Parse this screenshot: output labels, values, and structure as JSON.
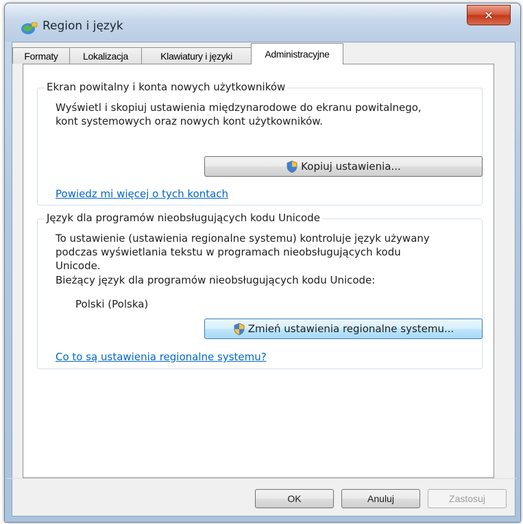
{
  "window": {
    "title": "Region i język",
    "close_label": "✕"
  },
  "tabs": [
    {
      "label": "Formaty",
      "active": false
    },
    {
      "label": "Lokalizacja",
      "active": false
    },
    {
      "label": "Klawiatury i języki",
      "active": false
    },
    {
      "label": "Administracyjne",
      "active": true
    }
  ],
  "welcome_group": {
    "title": "Ekran powitalny i konta nowych użytkowników",
    "description_line1": "Wyświetl i skopiuj ustawienia międzynarodowe do ekranu powitalnego,",
    "description_line2": "kont systemowych oraz nowych kont użytkowników.",
    "copy_button_label": "Kopiuj ustawienia...",
    "link_label": "Powiedz mi więcej o tych kontach"
  },
  "unicode_group": {
    "title": "Język dla programów nieobsługujących kodu Unicode",
    "description_line1": "To ustawienie (ustawienia regionalne systemu) kontroluje język używany",
    "description_line2": "podczas wyświetlania tekstu w programach nieobsługujących kodu",
    "description_line3": "Unicode.",
    "current_label": "Bieżący język dla programów nieobsługujących kodu Unicode:",
    "current_value": "Polski (Polska)",
    "change_button_label": "Zmień ustawienia regionalne systemu...",
    "link_label": "Co to są ustawienia regionalne systemu?"
  },
  "footer": {
    "ok_label": "OK",
    "cancel_label": "Anuluj",
    "apply_label": "Zastosuj"
  },
  "colors": {
    "link": "#0066cc",
    "close_button": "#c3391c",
    "focused_button": "#3c7fb1"
  },
  "icons": {
    "app": "globe-icon",
    "shield": "uac-shield-icon"
  }
}
